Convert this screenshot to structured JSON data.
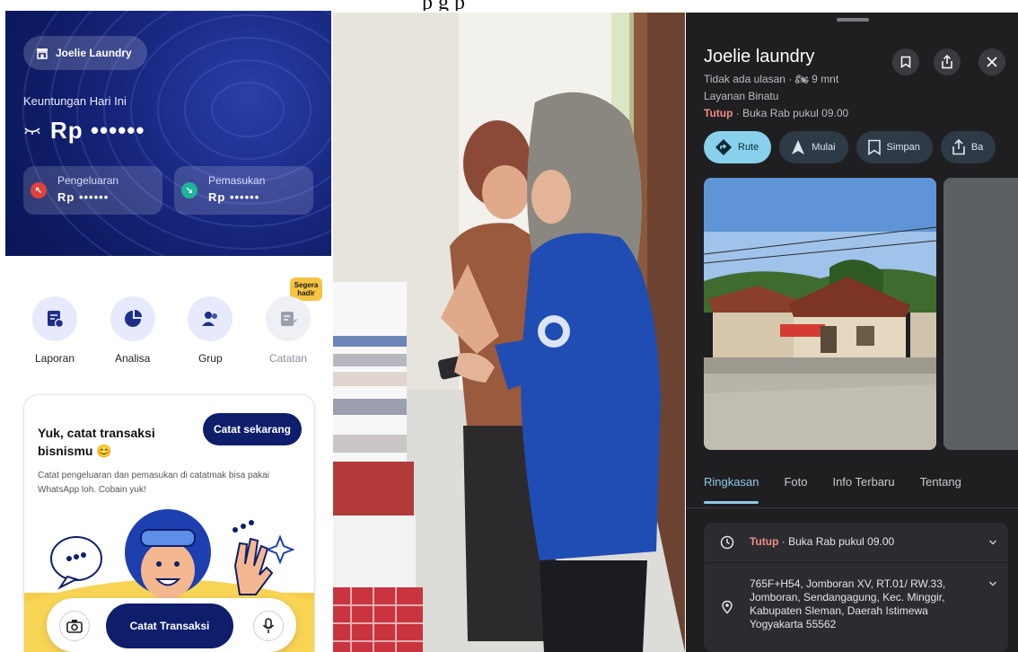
{
  "top_caption": "p                  g p",
  "finance_app": {
    "store_name": "Joelie Laundry",
    "profit_label": "Keuntungan Hari Ini",
    "profit_value": "Rp ••••••",
    "expense": {
      "label": "Pengeluaran",
      "value": "Rp ••••••",
      "color": "#e0423a"
    },
    "income": {
      "label": "Pemasukan",
      "value": "Rp ••••••",
      "color": "#1fb59a"
    },
    "menu": [
      {
        "label": "Laporan",
        "icon": "report-icon"
      },
      {
        "label": "Analisa",
        "icon": "pie-chart-icon"
      },
      {
        "label": "Grup",
        "icon": "group-icon"
      },
      {
        "label": "Catatan",
        "icon": "note-icon",
        "disabled": true
      }
    ],
    "soon_badge": "Segera hadir",
    "promo": {
      "title": "Yuk, catat transaksi bisnismu 😊",
      "button": "Catat sekarang",
      "description": "Catat pengeluaran dan pemasukan di catatmak bisa pakai WhatsApp loh. Cobain yuk!"
    },
    "bottom_bar": {
      "record_label": "Catat Transaksi",
      "camera_icon": "camera-icon",
      "mic_icon": "microphone-icon"
    },
    "accent_color": "#0e1e6b"
  },
  "maps_app": {
    "place_name": "Joelie laundry",
    "meta": "Tidak ada ulasan · 🏍 9 mnt",
    "category": "Layanan Binatu",
    "status_closed": "Tutup",
    "status_open_time": " · Buka Rab pukul 09.00",
    "actions": [
      {
        "label": "Rute",
        "icon": "directions-icon",
        "primary": true
      },
      {
        "label": "Mulai",
        "icon": "navigation-arrow-icon"
      },
      {
        "label": "Simpan",
        "icon": "bookmark-icon"
      },
      {
        "label": "Ba",
        "icon": "share-icon"
      }
    ],
    "tabs": [
      "Ringkasan",
      "Foto",
      "Info Terbaru",
      "Tentang"
    ],
    "hours_closed": "Tutup",
    "hours_text": " · Buka Rab pukul 09.00",
    "address": "765F+H54, Jomboran XV, RT.01/ RW.33, Jomboran, Sendangagung, Kec. Minggir, Kabupaten Sleman, Daerah Istimewa Yogyakarta 55562",
    "accent_color": "#88d0ec",
    "closed_color": "#f28b82"
  }
}
